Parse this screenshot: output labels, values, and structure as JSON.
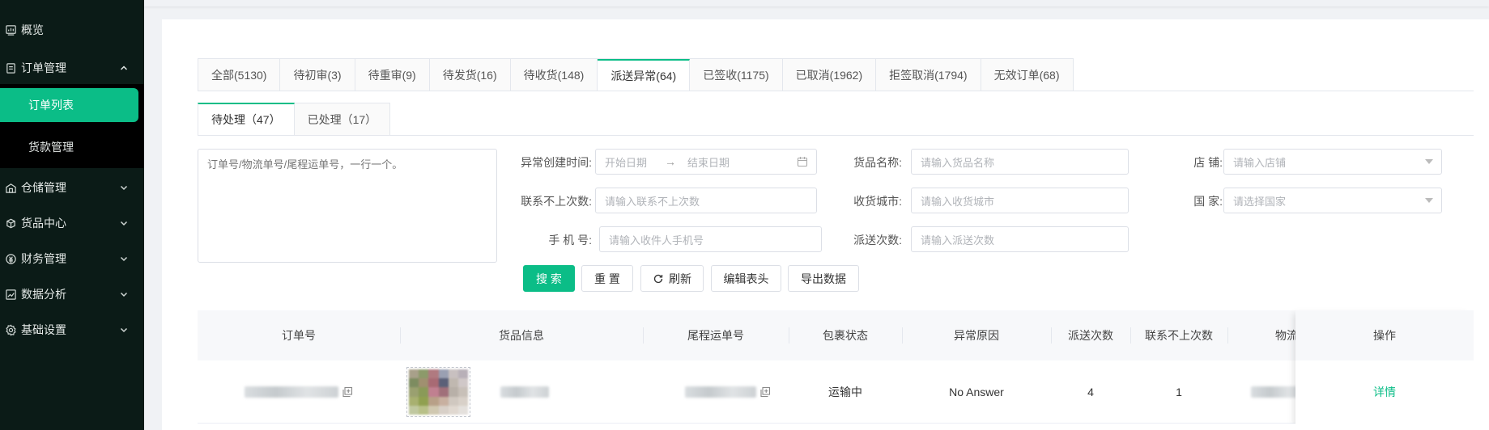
{
  "sidebar": {
    "items": [
      {
        "label": "概览",
        "icon": "dashboard-icon"
      },
      {
        "label": "订单管理",
        "icon": "order-icon",
        "expanded": true
      },
      {
        "label": "仓储管理",
        "icon": "warehouse-icon"
      },
      {
        "label": "货品中心",
        "icon": "goods-icon"
      },
      {
        "label": "财务管理",
        "icon": "finance-icon"
      },
      {
        "label": "数据分析",
        "icon": "chart-icon"
      },
      {
        "label": "基础设置",
        "icon": "settings-icon"
      }
    ],
    "sub_items": [
      {
        "label": "订单列表",
        "active": true
      },
      {
        "label": "货款管理"
      }
    ]
  },
  "tabs": [
    "全部(5130)",
    "待初审(3)",
    "待重审(9)",
    "待发货(16)",
    "待收货(148)",
    "派送异常(64)",
    "已签收(1175)",
    "已取消(1962)",
    "拒签取消(1794)",
    "无效订单(68)"
  ],
  "active_tab": "派送异常(64)",
  "subtabs": [
    "待处理（47）",
    "已处理（17）"
  ],
  "filters": {
    "textarea_placeholder": "订单号/物流单号/尾程运单号，一行一个。",
    "created_time_label": "异常创建时间:",
    "start_date_placeholder": "开始日期",
    "end_date_placeholder": "结束日期",
    "date_separator": "→",
    "goods_name_label": "货品名称:",
    "goods_name_placeholder": "请输入货品名称",
    "store_label": "店 铺:",
    "store_placeholder": "请输入店铺",
    "unreachable_label": "联系不上次数:",
    "unreachable_placeholder": "请输入联系不上次数",
    "city_label": "收货城市:",
    "city_placeholder": "请输入收货城市",
    "country_label": "国 家:",
    "country_placeholder": "请选择国家",
    "phone_label": "手 机 号:",
    "phone_placeholder": "请输入收件人手机号",
    "delivery_count_label": "派送次数:",
    "delivery_count_placeholder": "请输入派送次数"
  },
  "buttons": {
    "search": "搜 索",
    "reset": "重 置",
    "refresh": "刷新",
    "edit_header": "编辑表头",
    "export": "导出数据"
  },
  "table": {
    "headers": [
      "订单号",
      "货品信息",
      "尾程运单号",
      "包裹状态",
      "异常原因",
      "派送次数",
      "联系不上次数",
      "物流",
      "操作"
    ],
    "rows": [
      {
        "status": "运输中",
        "reason": "No Answer",
        "delivery_count": "4",
        "unreachable_count": "1",
        "action": "详情"
      }
    ]
  },
  "colors": {
    "accent": "#0bbd87",
    "sidebar_bg": "#0b1b17"
  }
}
